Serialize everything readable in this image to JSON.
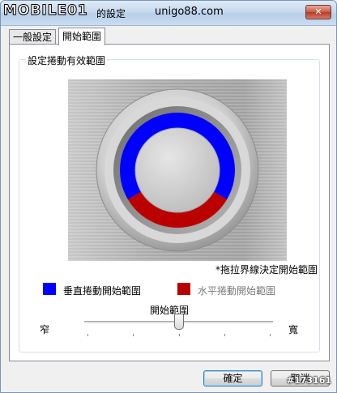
{
  "window": {
    "title": "的設定",
    "logo_text": "MOBILE01",
    "watermark": "unigo88.com",
    "close_label": "✕",
    "corner_watermark": "#173161"
  },
  "tabs": [
    {
      "label": "一般設定",
      "active": false
    },
    {
      "label": "開始範圍",
      "active": true
    }
  ],
  "panel": {
    "group_label": "設定捲動有效範圍",
    "hint": "*拖拉界線決定開始範圍",
    "legend": [
      {
        "label": "垂直捲動開始範圍",
        "color": "#0000ff"
      },
      {
        "label": "水平捲動開始範圍",
        "color": "#b50000"
      }
    ],
    "ring": {
      "vertical_color": "#0000ff",
      "horizontal_color": "#bb0000",
      "horizontal_fraction": 0.33
    },
    "slider": {
      "title": "開始範圍",
      "min_label": "窄",
      "max_label": "寬",
      "value_fraction": 0.5,
      "tick_count": 5
    }
  },
  "buttons": {
    "ok_label": "確定",
    "cancel_label": "取消"
  }
}
